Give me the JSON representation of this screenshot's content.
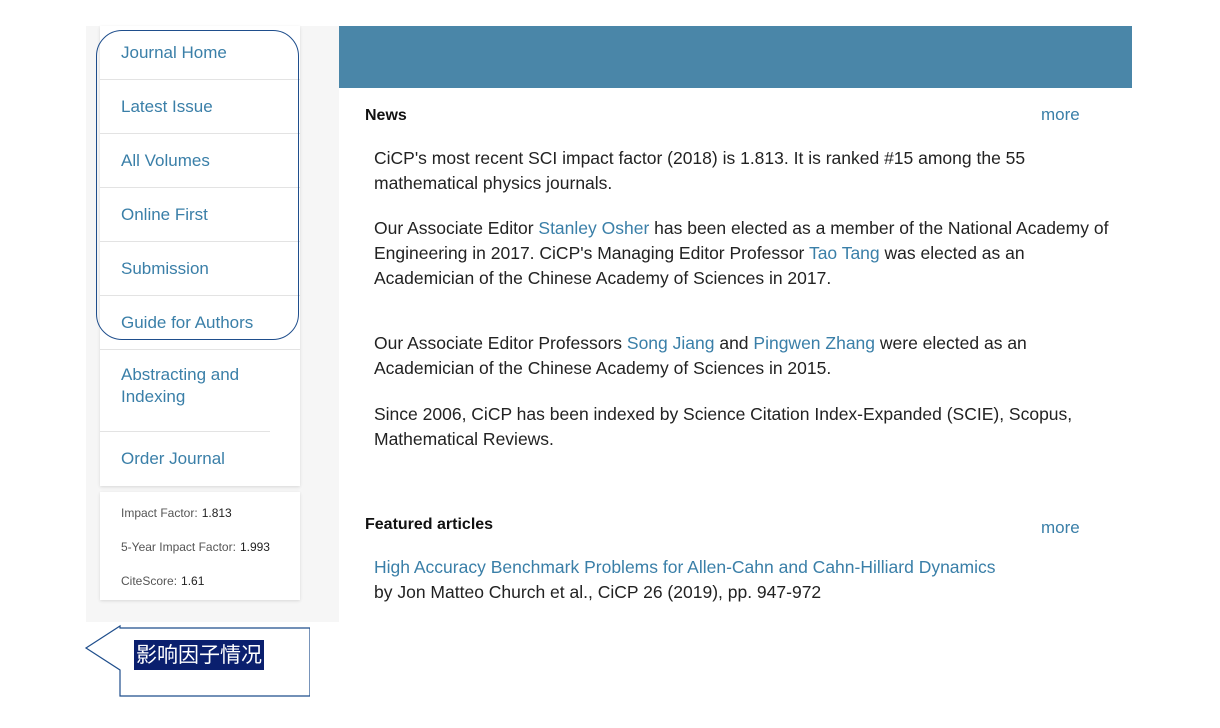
{
  "sidebar": {
    "items": [
      {
        "label": "Journal Home"
      },
      {
        "label": "Latest Issue"
      },
      {
        "label": "All Volumes"
      },
      {
        "label": "Online First"
      },
      {
        "label": "Submission"
      },
      {
        "label": "Guide for Authors"
      },
      {
        "label": "Abstracting and Indexing"
      },
      {
        "label": "Order Journal"
      }
    ]
  },
  "metrics": {
    "impact_factor": {
      "label": "Impact Factor:",
      "value": "1.813"
    },
    "five_year": {
      "label": "5-Year Impact Factor:",
      "value": "1.993"
    },
    "citescore": {
      "label": "CiteScore:",
      "value": "1.61"
    }
  },
  "news": {
    "title": "News",
    "more": "more",
    "p1": "CiCP's most recent SCI impact factor (2018) is 1.813. It is ranked #15 among the 55 mathematical physics journals.",
    "p2_a": "Our Associate Editor ",
    "p2_link1": "Stanley Osher",
    "p2_b": " has been elected as a member of the National Academy of Engineering in 2017. CiCP's Managing Editor Professor ",
    "p2_link2": "Tao Tang",
    "p2_c": " was elected as an Academician of the Chinese Academy of Sciences in 2017.",
    "p3_a": "Our Associate Editor Professors ",
    "p3_link1": "Song Jiang",
    "p3_b": " and ",
    "p3_link2": "Pingwen Zhang",
    "p3_c": " were elected as an Academician of the Chinese Academy of Sciences in 2015.",
    "p4": "Since 2006, CiCP has been indexed by Science Citation Index-Expanded (SCIE), Scopus, Mathematical Reviews."
  },
  "featured": {
    "title": "Featured articles",
    "more": "more",
    "article_title": "High Accuracy Benchmark Problems for Allen-Cahn and Cahn-Hilliard Dynamics",
    "article_meta": "by Jon Matteo Church et al., CiCP 26 (2019), pp. 947-972"
  },
  "annotation": {
    "callout_text": "影响因子情况"
  },
  "colors": {
    "header_blue": "#4a86a8",
    "link": "#3a7fa8",
    "annotation_stroke": "#1f4e8c",
    "callout_bg": "#0a1f6e"
  }
}
